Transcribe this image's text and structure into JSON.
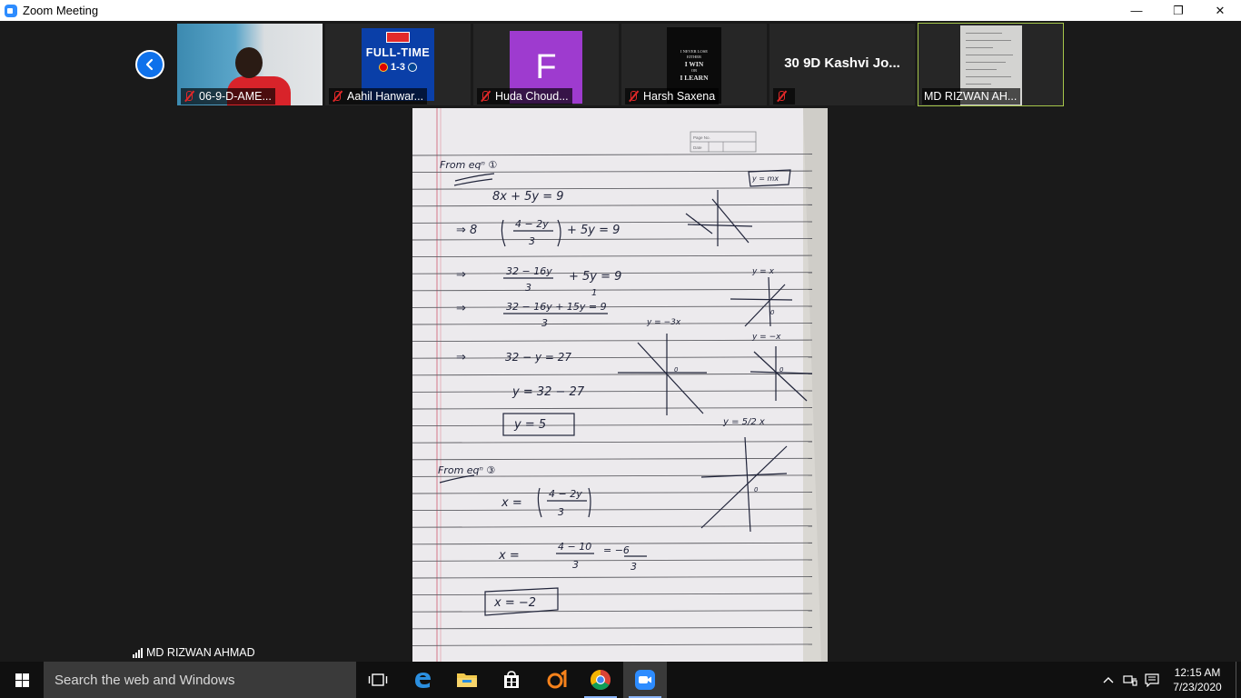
{
  "window": {
    "title": "Zoom Meeting",
    "minimize_glyph": "—",
    "maximize_glyph": "❐",
    "close_glyph": "✕"
  },
  "gallery": {
    "prev_icon": "chevron-left-icon",
    "tiles": [
      {
        "name": "06-9-D-AME...",
        "muted": true,
        "content": "camera-video"
      },
      {
        "name": "Aahil Hanwar...",
        "muted": true,
        "content": "profile-image",
        "poster": {
          "title": "FULL-TIME",
          "score": "1-3"
        }
      },
      {
        "name": "Huda Choud...",
        "muted": true,
        "content": "letter-avatar",
        "letter": "F",
        "color": "#9e3bcf"
      },
      {
        "name": "Harsh Saxena",
        "muted": true,
        "content": "profile-image",
        "poster": {
          "line1": "I NEVER LOSE",
          "line2": "EITHER",
          "line3": "I WIN",
          "line4": "OR",
          "line5": "I LEARN"
        }
      },
      {
        "name": "30 9D Kashvi Jo...",
        "muted": true,
        "content": "name-only"
      },
      {
        "name": "MD RIZWAN AH...",
        "muted": false,
        "content": "screen-thumbnail",
        "active": true
      }
    ]
  },
  "shared_screen": {
    "type": "handwritten-notebook",
    "texts": {
      "page_no": "Page No.",
      "date": "Date",
      "from_eq1": "From eqⁿ ①",
      "l1": "8x + 5y = 9",
      "l2a": "⇒  8",
      "l2b": "4 − 2y",
      "l2c": "3",
      "l2d": "+ 5y = 9",
      "l3a": "⇒",
      "l3b": "32 − 16y",
      "l3c": "3",
      "l3d": "+ 5y = 9",
      "l3e": "1",
      "l4a": "⇒",
      "l4b": "32 − 16y + 15y = 9",
      "l4c": "3",
      "l5a": "⇒",
      "l5b": "32 − y = 27",
      "l6": "y = 32 − 27",
      "l7": "y = 5",
      "from_eq3": "From eqⁿ ③",
      "l8a": "x =",
      "l8b": "4 − 2y",
      "l8c": "3",
      "l9a": "x =",
      "l9b": "4 − 10",
      "l9c": "3",
      "l9d": "= −6",
      "l9e": "3",
      "l10": "x = −2",
      "g_ymx": "y = mx",
      "g_yx": "y = x",
      "g_ym3x": "y = −3x",
      "g_ymx2": "y = −x",
      "g_y52x": "y = 5/2 x",
      "origin": "0"
    }
  },
  "active_speaker": {
    "name": "MD RIZWAN AHMAD"
  },
  "taskbar": {
    "search_placeholder": "Search the web and Windows",
    "apps": [
      "task-view-icon",
      "edge-icon",
      "file-explorer-icon",
      "store-icon",
      "app-icon",
      "chrome-icon",
      "zoom-icon"
    ],
    "time": "12:15 AM",
    "date": "7/23/2020"
  }
}
